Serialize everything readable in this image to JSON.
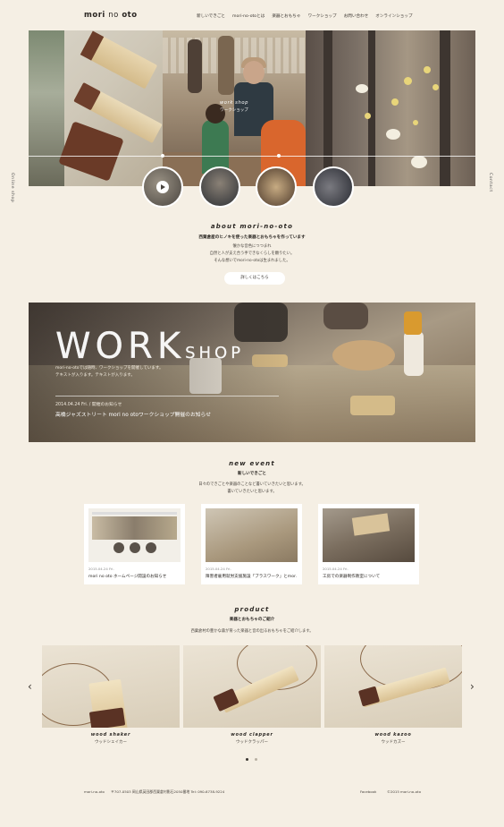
{
  "header": {
    "logo_bold": "mori",
    "logo_thin": "no",
    "logo_bold2": "oto",
    "nav": [
      "新しいできごと",
      "mori-no-otoとは",
      "楽器とおもちゃ",
      "ワークショップ",
      "お問い合わせ",
      "オンラインショップ"
    ]
  },
  "side": {
    "left": "Online shop",
    "right": "Contact"
  },
  "hero": {
    "workshop_en": "work shop",
    "workshop_jp": "ワークショップ"
  },
  "about": {
    "title": "about mori-no-oto",
    "subtitle": "西粟倉産のヒノキを使った楽器とおもちゃを作っています",
    "body": [
      "懐かな音色につつまれ",
      "自然と人が支え合う手できなくらしを願りたい。",
      "そんな想いでmori-no-otoは生まれました。"
    ],
    "button": "詳しくはこちら"
  },
  "workshop": {
    "title_big": "WORK",
    "title_small": "SHOP",
    "desc": [
      "mori-no-otoでは随時、ワークショップを開催しています。",
      "テキストが入ります。テキストが入ります。"
    ],
    "date": "2014.04.24 Fri.  /  開催のお知らせ",
    "news": "高橋ジャズストリート mori no otoワークショップ開催のお知らせ"
  },
  "news": {
    "title": "new event",
    "subtitle": "新しいできごと",
    "body": [
      "日々のできごとや楽器のことなど書いていきたいと思います。",
      "書いていきたいと思います。"
    ],
    "cards": [
      {
        "date": "2015.04.24 Fri.",
        "title": "mori no oto ホームページ開設のお知らせ"
      },
      {
        "date": "2015.04.24 Fri.",
        "title": "障害者雇用就労支援施設「ブラスワーク」とmor…"
      },
      {
        "date": "2015.04.24 Fri.",
        "title": "工房での楽器制作教室について"
      }
    ]
  },
  "products": {
    "title": "product",
    "subtitle": "楽器とおもちゃのご紹介",
    "body": "西粟倉村の豊かな森が育った楽器と音の出るおもちゃをご紹介します。",
    "items": [
      {
        "en": "wood shaker",
        "jp": "ウッドシェイカー"
      },
      {
        "en": "wood clapper",
        "jp": "ウッドクラッパー"
      },
      {
        "en": "wood kazoo",
        "jp": "ウッドカズー"
      }
    ],
    "prev": "‹",
    "next": "›"
  },
  "footer": {
    "brand": "mori-no-oto",
    "address": "〒707-0503 岡山県英田郡西粟倉村影石2050番地   Tel: 090-6738-9224",
    "facebook": "Facebook",
    "copyright": "©2015 mori-no-oto"
  },
  "colors": {
    "background": "#f5efe4",
    "text": "#3a3530",
    "card": "#ffffff"
  }
}
